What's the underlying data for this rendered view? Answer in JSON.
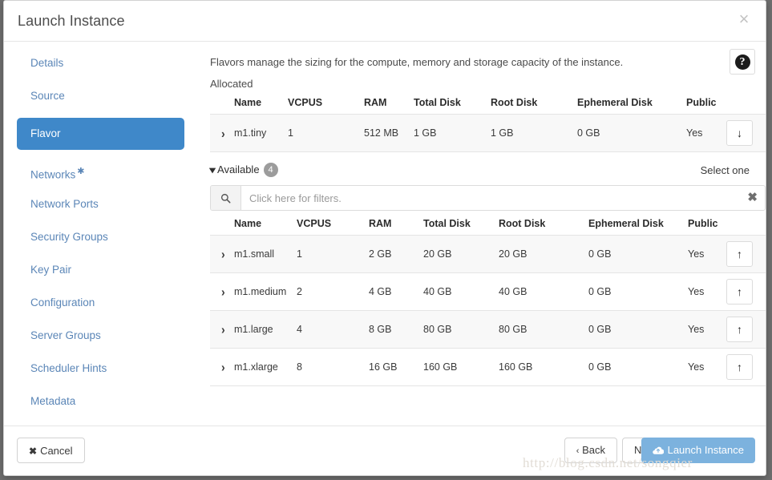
{
  "dialog": {
    "title": "Launch Instance",
    "close_icon": "×"
  },
  "sidebar": {
    "items": [
      {
        "label": "Details",
        "active": false,
        "required": false
      },
      {
        "label": "Source",
        "active": false,
        "required": false
      },
      {
        "label": "Flavor",
        "active": true,
        "required": false
      },
      {
        "label": "Networks",
        "active": false,
        "required": true
      },
      {
        "label": "Network Ports",
        "active": false,
        "required": false
      },
      {
        "label": "Security Groups",
        "active": false,
        "required": false
      },
      {
        "label": "Key Pair",
        "active": false,
        "required": false
      },
      {
        "label": "Configuration",
        "active": false,
        "required": false
      },
      {
        "label": "Server Groups",
        "active": false,
        "required": false
      },
      {
        "label": "Scheduler Hints",
        "active": false,
        "required": false
      },
      {
        "label": "Metadata",
        "active": false,
        "required": false
      }
    ]
  },
  "content": {
    "description": "Flavors manage the sizing for the compute, memory and storage capacity of the instance.",
    "help_icon": "?",
    "allocated": {
      "label": "Allocated",
      "columns": [
        "Name",
        "VCPUS",
        "RAM",
        "Total Disk",
        "Root Disk",
        "Ephemeral Disk",
        "Public"
      ],
      "rows": [
        {
          "expander": "›",
          "name": "m1.tiny",
          "vcpus": "1",
          "ram": "512 MB",
          "total_disk": "1 GB",
          "root_disk": "1 GB",
          "ephemeral_disk": "0 GB",
          "public": "Yes",
          "action_icon": "↓"
        }
      ]
    },
    "available": {
      "label": "Available",
      "count": "4",
      "caret": "⌄",
      "select_hint": "Select one",
      "filter": {
        "placeholder": "Click here for filters.",
        "value": "",
        "search_icon": "⚲",
        "clear_icon": "✖"
      },
      "columns": [
        "Name",
        "VCPUS",
        "RAM",
        "Total Disk",
        "Root Disk",
        "Ephemeral Disk",
        "Public"
      ],
      "rows": [
        {
          "expander": "›",
          "name": "m1.small",
          "vcpus": "1",
          "ram": "2 GB",
          "total_disk": "20 GB",
          "root_disk": "20 GB",
          "ephemeral_disk": "0 GB",
          "public": "Yes",
          "action_icon": "↑"
        },
        {
          "expander": "›",
          "name": "m1.medium",
          "vcpus": "2",
          "ram": "4 GB",
          "total_disk": "40 GB",
          "root_disk": "40 GB",
          "ephemeral_disk": "0 GB",
          "public": "Yes",
          "action_icon": "↑"
        },
        {
          "expander": "›",
          "name": "m1.large",
          "vcpus": "4",
          "ram": "8 GB",
          "total_disk": "80 GB",
          "root_disk": "80 GB",
          "ephemeral_disk": "0 GB",
          "public": "Yes",
          "action_icon": "↑"
        },
        {
          "expander": "›",
          "name": "m1.xlarge",
          "vcpus": "8",
          "ram": "16 GB",
          "total_disk": "160 GB",
          "root_disk": "160 GB",
          "ephemeral_disk": "0 GB",
          "public": "Yes",
          "action_icon": "↑"
        }
      ]
    }
  },
  "footer": {
    "cancel": "Cancel",
    "cancel_icon": "✖",
    "back": "Back",
    "back_icon": "‹",
    "next": "Next",
    "next_icon": "›",
    "launch": "Launch Instance"
  },
  "watermark": "http://blog.csdn.net/songqier",
  "colors": {
    "active_nav": "#3f88c9",
    "nav_link": "#5b86b7",
    "primary_button": "#7cb2de",
    "badge": "#9c9c9c",
    "row_stripe": "#f8f8f8"
  }
}
